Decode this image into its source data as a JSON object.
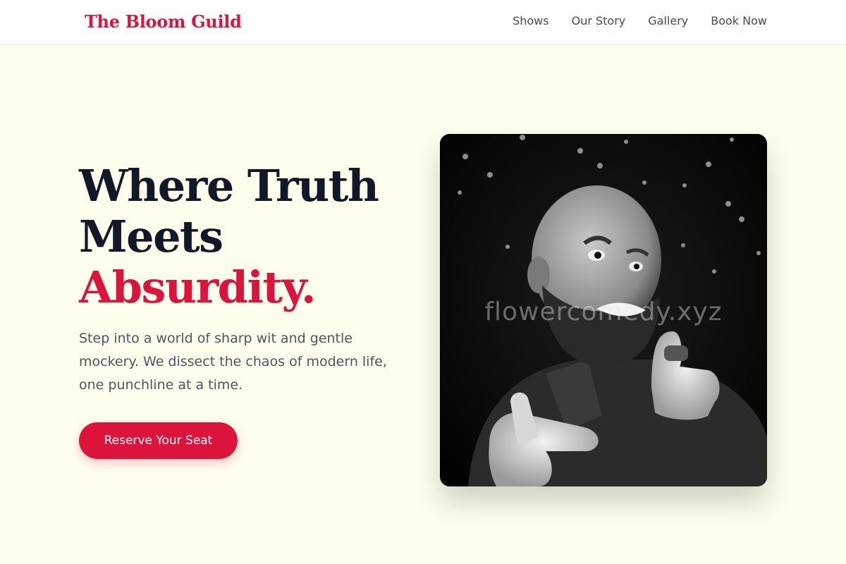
{
  "brand": {
    "name": "The Bloom Guild",
    "accent_color": "#dc143c"
  },
  "nav": {
    "links": [
      {
        "label": "Shows"
      },
      {
        "label": "Our Story"
      },
      {
        "label": "Gallery"
      },
      {
        "label": "Book Now"
      }
    ]
  },
  "hero": {
    "title_line_1": "Where Truth",
    "title_line_2": "Meets",
    "title_line_3": "Absurdity.",
    "subtitle": "Step into a world of sharp wit and gentle mockery. We dissect the chaos of modern life, one punchline at a time.",
    "cta_label": "Reserve Your Seat",
    "image": {
      "description_icon": "comedian-photo",
      "watermark": "flowercomedy.xyz"
    }
  },
  "colors": {
    "background": "#fefeec",
    "primary": "#dc143c",
    "heading": "#111827",
    "body": "#4e5561"
  }
}
